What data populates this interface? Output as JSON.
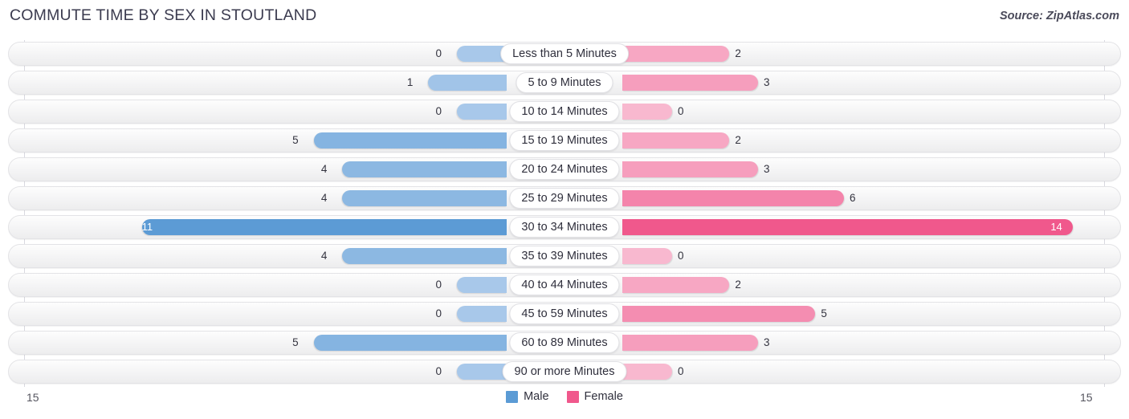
{
  "header": {
    "title": "COMMUTE TIME BY SEX IN STOUTLAND",
    "source": "Source: ZipAtlas.com"
  },
  "axis": {
    "left_label": "15",
    "right_label": "15"
  },
  "legend": {
    "items": [
      {
        "label": "Male",
        "color": "#5b9bd5"
      },
      {
        "label": "Female",
        "color": "#f0588c"
      }
    ]
  },
  "colors": {
    "male_strong": "#5b9bd5",
    "male_light": "#a8c8ea",
    "female_strong": "#f0588c",
    "female_light": "#f8b8cf",
    "track": "#f4f4f5",
    "gridline": "#d9d9e0"
  },
  "chart_data": {
    "type": "bar",
    "title": "COMMUTE TIME BY SEX IN STOUTLAND",
    "subtitle": "Source: ZipAtlas.com",
    "orientation": "horizontal",
    "layout": "diverging-bidirectional",
    "xlabel": "",
    "ylabel": "",
    "xlim": [
      15,
      15
    ],
    "axis_max": 15,
    "grid": true,
    "legend_position": "bottom-center",
    "categories": [
      "Less than 5 Minutes",
      "5 to 9 Minutes",
      "10 to 14 Minutes",
      "15 to 19 Minutes",
      "20 to 24 Minutes",
      "25 to 29 Minutes",
      "30 to 34 Minutes",
      "35 to 39 Minutes",
      "40 to 44 Minutes",
      "45 to 59 Minutes",
      "60 to 89 Minutes",
      "90 or more Minutes"
    ],
    "series": [
      {
        "name": "Male",
        "side": "left",
        "values": [
          0,
          1,
          0,
          5,
          4,
          4,
          11,
          4,
          0,
          0,
          5,
          0
        ]
      },
      {
        "name": "Female",
        "side": "right",
        "values": [
          2,
          3,
          0,
          2,
          3,
          6,
          14,
          0,
          2,
          5,
          3,
          0
        ]
      }
    ]
  }
}
